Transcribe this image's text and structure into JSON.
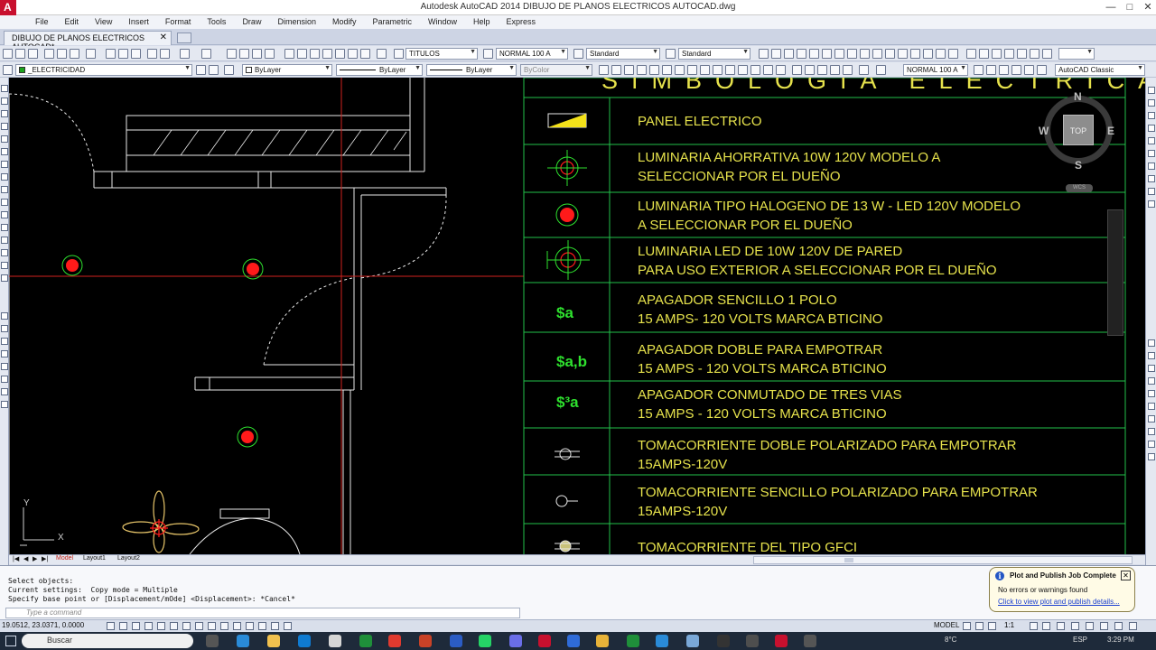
{
  "window": {
    "title": "Autodesk AutoCAD 2014    DIBUJO DE PLANOS ELECTRICOS AUTOCAD.dwg",
    "controls": [
      "—",
      "□",
      "✕"
    ]
  },
  "menu": [
    "File",
    "Edit",
    "View",
    "Insert",
    "Format",
    "Tools",
    "Draw",
    "Dimension",
    "Modify",
    "Parametric",
    "Window",
    "Help",
    "Express"
  ],
  "document_tab": {
    "label": "DIBUJO DE PLANOS ELECTRICOS AUTOCAD*",
    "close": "✕"
  },
  "toolbar1": {
    "text_style": "TITULOS",
    "dim_style": "NORMAL 100 A",
    "table_style": "Standard",
    "mleader_style": "Standard"
  },
  "toolbar2": {
    "layer": "_ELECTRICIDAD",
    "color": "ByLayer",
    "linetype": "ByLayer",
    "lineweight": "ByLayer",
    "plotstyle": "ByColor",
    "annotation_scale": "NORMAL 100 A",
    "workspace": "AutoCAD Classic"
  },
  "drawing": {
    "legend_title": "SIMBOLOGIA  ELECTRICA",
    "colors": {
      "text": "#e6e24c",
      "grid": "#22c04a",
      "symbol_green": "#2ee02e",
      "red": "#ff1a1a"
    },
    "rows": [
      {
        "symbol": "panel-icon",
        "line1": "PANEL ELECTRICO",
        "line2": ""
      },
      {
        "symbol": "crosshair-luminaire-icon",
        "line1": "LUMINARIA AHORRATIVA 10W 120V MODELO A",
        "line2": "SELECCIONAR POR EL DUEÑO"
      },
      {
        "symbol": "red-dot-icon",
        "line1": "LUMINARIA TIPO HALOGENO DE 13 W - LED 120V MODELO",
        "line2": "A SELECCIONAR POR EL DUEÑO"
      },
      {
        "symbol": "wall-luminaire-icon",
        "line1": "LUMINARIA LED DE 10W 120V DE PARED",
        "line2": "PARA USO EXTERIOR A SELECCIONAR POR EL DUEÑO"
      },
      {
        "symbol_text": "$a",
        "line1": "APAGADOR SENCILLO 1 POLO",
        "line2": "15 AMPS- 120 VOLTS MARCA BTICINO"
      },
      {
        "symbol_text": "$a,b",
        "line1": "APAGADOR DOBLE PARA EMPOTRAR",
        "line2": "15 AMPS - 120 VOLTS MARCA BTICINO"
      },
      {
        "symbol_text": "$³a",
        "line1": "APAGADOR CONMUTADO DE TRES VIAS",
        "line2": "15 AMPS - 120 VOLTS MARCA BTICINO"
      },
      {
        "symbol": "double-outlet-icon",
        "line1": "TOMACORRIENTE DOBLE POLARIZADO PARA EMPOTRAR",
        "line2": "15AMPS-120V"
      },
      {
        "symbol": "single-outlet-icon",
        "line1": "TOMACORRIENTE SENCILLO POLARIZADO PARA EMPOTRAR",
        "line2": "15AMPS-120V"
      },
      {
        "symbol": "gfci-outlet-icon",
        "line1": "TOMACORRIENTE DEL TIPO GFCI",
        "line2": ""
      }
    ],
    "viewcube": {
      "n": "N",
      "s": "S",
      "e": "E",
      "w": "W",
      "face": "TOP",
      "wcs": "WCS"
    },
    "ucs": {
      "x": "X",
      "y": "Y"
    }
  },
  "layout_tabs": [
    "Model",
    "Layout1",
    "Layout2"
  ],
  "command_history": [
    "Select objects:",
    "Current settings:  Copy mode = Multiple",
    "Specify base point or [Displacement/mOde] <Displacement>: *Cancel*"
  ],
  "command_placeholder": "Type a command",
  "status": {
    "coords": "19.0512, 23.0371, 0.0000",
    "space": "MODEL",
    "scale": "1:1"
  },
  "notification": {
    "title": "Plot and Publish Job Complete",
    "body": "No errors or warnings found",
    "link": "Click to view plot and publish details..."
  },
  "taskbar": {
    "search_placeholder": "Buscar",
    "weather": "8°C",
    "lang": "ESP",
    "time": "3:29 PM"
  }
}
